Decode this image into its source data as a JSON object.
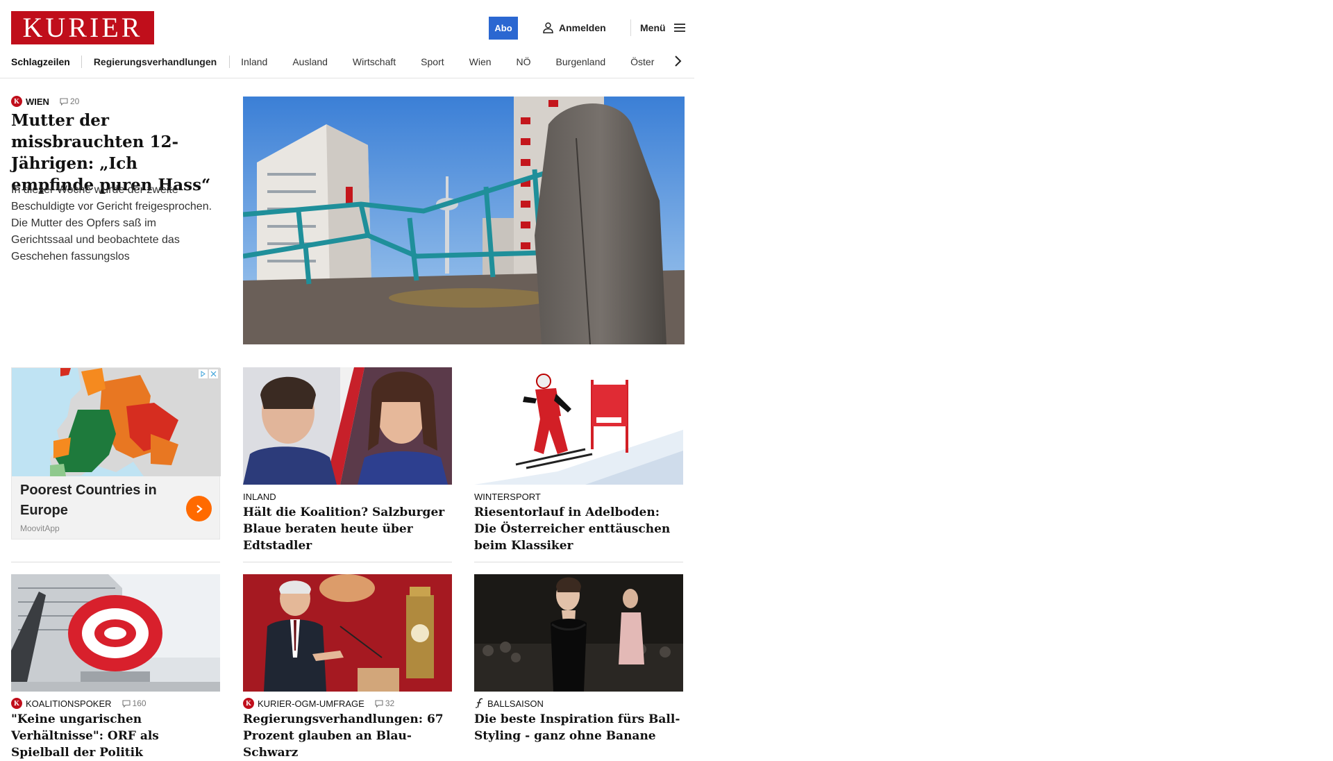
{
  "brand": {
    "logo_text": "KURIER",
    "color": "#c00e1b"
  },
  "header": {
    "abo_label": "Abo",
    "login_label": "Anmelden",
    "menu_label": "Menü",
    "accent_color": "#2b67d1"
  },
  "nav": {
    "items": [
      "Schlagzeilen",
      "Regierungsverhandlungen",
      "Inland",
      "Ausland",
      "Wirtschaft",
      "Sport",
      "Wien",
      "NÖ",
      "Burgenland",
      "Öster"
    ]
  },
  "lead": {
    "section": "WIEN",
    "comments": "20",
    "title": "Mutter der missbrauch­ten 12-Jährigen: „Ich empfinde puren Hass“",
    "teaser": "In dieser Woche wurde der zweite Beschuldigte vor Gericht freigesprochen. Die Mutter des Opfers saß im Gerichtssaal und beobachtete das Geschehen fassungslos"
  },
  "ad": {
    "title": "Poorest Countries in Europe",
    "source": "MoovitApp",
    "button_color": "#ff6a00"
  },
  "cards": [
    {
      "section": "INLAND",
      "title": "Hält die Koalition? Salzburger Blaue beraten heute über Edtstadler"
    },
    {
      "section": "WINTERSPORT",
      "title": "Riesentorlauf in Adelboden: Die Ös­terreicher enttäuschen beim Klassiker"
    },
    {
      "section": "KOALITIONSPOKER",
      "comments": "160",
      "title": "\"Keine ungarischen Verhältnisse\": ORF als Spielball der Politik"
    },
    {
      "section": "KURIER-OGM-UMFRAGE",
      "comments": "32",
      "title": "Regierungsverhandlungen: 67 Pro­zent glauben an Blau-Schwarz"
    },
    {
      "section": "BALLSAISON",
      "title": "Die beste Inspiration fürs Ball-Sty­ling - ganz ohne Banane"
    }
  ]
}
